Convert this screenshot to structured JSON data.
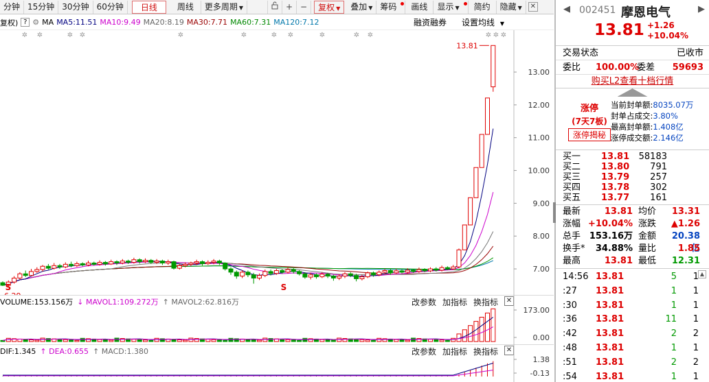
{
  "toolbar": {
    "items": [
      "分钟",
      "15分钟",
      "30分钟",
      "60分钟",
      "日线",
      "周线",
      "更多周期"
    ],
    "active": "日线",
    "fq": "复权",
    "overlay": "叠加",
    "chip": "筹码",
    "draw": "画线",
    "display": "显示",
    "simple": "简约",
    "hide": "隐藏"
  },
  "ma_legend": {
    "prefix": "复权)",
    "ma": "MA",
    "ma5": "MA5:11.51",
    "ma10": "MA10:9.49",
    "ma20": "MA20:8.19",
    "ma30": "MA30:7.71",
    "ma60": "MA60:7.31",
    "ma120": "MA120:7.12",
    "margin": "融资融券",
    "set_ma": "设置均线"
  },
  "colors": {
    "up": "#e00000",
    "down": "#009900",
    "ma5": "#000080",
    "ma10": "#cc00cc",
    "ma20": "#777777",
    "ma30": "#990000",
    "ma60": "#009900",
    "ma120": "#0077aa"
  },
  "chart_data": {
    "type": "candlestick",
    "yticks": [
      "13.00",
      "12.00",
      "11.00",
      "10.00",
      "9.00",
      "8.00",
      "7.00"
    ],
    "ylim": [
      6.5,
      13.9
    ],
    "last_price_label": "13.81",
    "low_label": "6.29",
    "candles": [
      [
        6.58,
        6.5,
        6.62,
        6.48
      ],
      [
        6.5,
        6.6,
        6.65,
        6.45
      ],
      [
        6.6,
        6.72,
        6.78,
        6.55
      ],
      [
        6.72,
        6.85,
        6.9,
        6.68
      ],
      [
        6.85,
        6.8,
        6.95,
        6.75
      ],
      [
        6.8,
        6.92,
        7.0,
        6.78
      ],
      [
        6.92,
        6.98,
        7.05,
        6.88
      ],
      [
        6.98,
        7.08,
        7.12,
        6.92
      ],
      [
        7.08,
        7.02,
        7.15,
        6.98
      ],
      [
        7.02,
        7.1,
        7.18,
        6.98
      ],
      [
        7.1,
        7.06,
        7.15,
        7.0
      ],
      [
        7.06,
        7.14,
        7.2,
        7.02
      ],
      [
        7.14,
        7.1,
        7.22,
        7.05
      ],
      [
        7.1,
        7.16,
        7.22,
        7.06
      ],
      [
        7.16,
        7.12,
        7.2,
        7.08
      ],
      [
        7.12,
        7.18,
        7.25,
        7.08
      ],
      [
        7.18,
        7.14,
        7.22,
        7.1
      ],
      [
        7.14,
        7.2,
        7.26,
        7.1
      ],
      [
        7.2,
        7.15,
        7.24,
        7.1
      ],
      [
        7.15,
        7.22,
        7.28,
        7.12
      ],
      [
        7.22,
        7.18,
        7.26,
        7.12
      ],
      [
        7.18,
        7.24,
        7.3,
        7.14
      ],
      [
        7.24,
        7.2,
        7.28,
        7.15
      ],
      [
        7.2,
        7.28,
        7.34,
        7.16
      ],
      [
        7.28,
        7.22,
        7.32,
        7.16
      ],
      [
        7.22,
        7.26,
        7.32,
        7.18
      ],
      [
        7.26,
        7.2,
        7.3,
        7.15
      ],
      [
        7.2,
        7.24,
        7.3,
        7.15
      ],
      [
        7.24,
        7.18,
        7.28,
        7.12
      ],
      [
        7.18,
        7.22,
        7.28,
        7.12
      ],
      [
        7.22,
        7.02,
        7.25,
        6.98
      ],
      [
        7.02,
        7.1,
        7.15,
        6.98
      ],
      [
        7.1,
        7.14,
        7.2,
        7.05
      ],
      [
        7.14,
        7.18,
        7.22,
        7.08
      ],
      [
        7.18,
        7.22,
        7.28,
        7.12
      ],
      [
        7.22,
        7.16,
        7.26,
        7.1
      ],
      [
        7.16,
        7.2,
        7.26,
        7.12
      ],
      [
        7.2,
        7.24,
        7.3,
        7.14
      ],
      [
        7.24,
        7.18,
        7.28,
        7.12
      ],
      [
        7.18,
        7.0,
        7.2,
        6.95
      ],
      [
        7.0,
        6.9,
        7.05,
        6.82
      ],
      [
        6.9,
        6.78,
        6.95,
        6.7
      ],
      [
        6.78,
        6.9,
        6.96,
        6.72
      ],
      [
        6.9,
        6.82,
        6.95,
        6.75
      ],
      [
        6.82,
        6.72,
        6.88,
        6.55
      ],
      [
        6.72,
        6.8,
        6.86,
        6.66
      ],
      [
        6.8,
        6.92,
        6.98,
        6.75
      ],
      [
        6.92,
        6.86,
        6.98,
        6.8
      ],
      [
        6.86,
        6.95,
        7.0,
        6.82
      ],
      [
        6.95,
        6.9,
        7.0,
        6.85
      ],
      [
        6.9,
        6.98,
        7.04,
        6.86
      ],
      [
        6.98,
        6.92,
        7.02,
        6.86
      ],
      [
        6.92,
        6.85,
        6.96,
        6.8
      ],
      [
        6.85,
        6.75,
        6.9,
        6.7
      ],
      [
        6.75,
        6.82,
        6.88,
        6.68
      ],
      [
        6.82,
        6.76,
        6.86,
        6.7
      ],
      [
        6.76,
        6.84,
        6.9,
        6.72
      ],
      [
        6.84,
        6.78,
        6.88,
        6.72
      ],
      [
        6.78,
        6.72,
        6.82,
        6.64
      ],
      [
        6.72,
        6.78,
        6.84,
        6.66
      ],
      [
        6.78,
        6.85,
        6.9,
        6.72
      ],
      [
        6.85,
        6.8,
        6.9,
        6.75
      ],
      [
        6.8,
        6.7,
        6.85,
        6.62
      ],
      [
        6.7,
        6.76,
        6.82,
        6.65
      ],
      [
        6.76,
        6.88,
        6.92,
        6.72
      ],
      [
        6.88,
        6.82,
        6.92,
        6.76
      ],
      [
        6.82,
        6.9,
        6.95,
        6.78
      ],
      [
        6.9,
        6.95,
        7.0,
        6.85
      ],
      [
        6.95,
        6.88,
        7.0,
        6.82
      ],
      [
        6.88,
        6.94,
        7.0,
        6.84
      ],
      [
        6.94,
        6.9,
        6.98,
        6.86
      ],
      [
        6.9,
        6.96,
        7.02,
        6.86
      ],
      [
        6.96,
        6.92,
        7.0,
        6.88
      ],
      [
        6.92,
        6.98,
        7.04,
        6.88
      ],
      [
        6.98,
        6.94,
        7.02,
        6.9
      ],
      [
        6.94,
        7.0,
        7.05,
        6.9
      ],
      [
        7.0,
        6.96,
        7.05,
        6.92
      ],
      [
        6.96,
        7.04,
        7.1,
        6.92
      ],
      [
        7.04,
        7.0,
        7.08,
        6.96
      ],
      [
        7.0,
        7.06,
        7.12,
        6.98
      ],
      [
        7.06,
        7.58,
        7.62,
        7.02
      ],
      [
        7.58,
        8.34,
        8.34,
        7.58
      ],
      [
        8.34,
        9.17,
        9.17,
        9.1
      ],
      [
        9.17,
        10.09,
        10.09,
        10.09
      ],
      [
        10.09,
        11.1,
        11.1,
        10.2
      ],
      [
        11.1,
        12.21,
        12.21,
        11.3
      ],
      [
        12.55,
        13.81,
        13.81,
        12.4
      ]
    ],
    "vol_ticks": [
      "173.00",
      "0.00"
    ],
    "macd_ticks": [
      "1.38",
      "-0.13"
    ]
  },
  "vol_panel": {
    "vol": "VOLUME:153.156万",
    "mavol1": "MAVOL1:109.272万",
    "mavol2": "MAVOL2:62.816万",
    "tools": [
      "改参数",
      "加指标",
      "换指标"
    ]
  },
  "macd_panel": {
    "dif": "DIF:1.345",
    "dea": "DEA:0.655",
    "macd": "MACD:1.380",
    "tools": [
      "改参数",
      "加指标",
      "换指标"
    ]
  },
  "quote": {
    "code": "002451",
    "name": "摩恩电气",
    "price": "13.81",
    "change": "+1.26",
    "change_pct": "+10.04%",
    "state_label": "交易状态",
    "state_value": "已收市",
    "wb_label": "委比",
    "wb_value": "100.00%",
    "wc_label": "委差",
    "wc_value": "59693",
    "l2_link": "购买L2查看十档行情"
  },
  "limit_up": {
    "title": "涨停",
    "streak": "(7天7板)",
    "reveal": "涨停揭秘",
    "rows": [
      {
        "k": "当前封单额:",
        "v": "8035.07万"
      },
      {
        "k": "封单占成交:",
        "v": "3.80%"
      },
      {
        "k": "最高封单额:",
        "v": "1.408亿"
      },
      {
        "k": "涨停成交额:",
        "v": "2.146亿"
      }
    ]
  },
  "book": [
    {
      "l": "买一",
      "p": "13.81",
      "q": "58183"
    },
    {
      "l": "买二",
      "p": "13.80",
      "q": "791"
    },
    {
      "l": "买三",
      "p": "13.79",
      "q": "257"
    },
    {
      "l": "买四",
      "p": "13.78",
      "q": "302"
    },
    {
      "l": "买五",
      "p": "13.77",
      "q": "161"
    }
  ],
  "stats": [
    {
      "k1": "最新",
      "v1": "13.81",
      "c1": "red",
      "k2": "均价",
      "v2": "13.31",
      "c2": "red"
    },
    {
      "k1": "涨幅",
      "v1": "+10.04%",
      "c1": "red",
      "k2": "涨跌",
      "v2": "▲1.26",
      "c2": "red"
    },
    {
      "k1": "总手",
      "v1": "153.16万",
      "c1": "",
      "k2": "金额",
      "v2": "20.38亿",
      "c2": "blue"
    },
    {
      "k1": "换手*",
      "v1": "34.88%",
      "c1": "",
      "k2": "量比",
      "v2": "1.85",
      "c2": "red"
    },
    {
      "k1": "最高",
      "v1": "13.81",
      "c1": "red",
      "k2": "最低",
      "v2": "12.31",
      "c2": "green"
    }
  ],
  "ticks": [
    {
      "t": "14:56",
      "p": "13.81",
      "v": "5",
      "n": "1"
    },
    {
      "t": ":27",
      "p": "13.81",
      "v": "1",
      "n": "1"
    },
    {
      "t": ":30",
      "p": "13.81",
      "v": "1",
      "n": "1"
    },
    {
      "t": ":36",
      "p": "13.81",
      "v": "11",
      "n": "1"
    },
    {
      "t": ":42",
      "p": "13.81",
      "v": "2",
      "n": "2"
    },
    {
      "t": ":48",
      "p": "13.81",
      "v": "1",
      "n": "1"
    },
    {
      "t": ":51",
      "p": "13.81",
      "v": "2",
      "n": "2"
    },
    {
      "t": ":54",
      "p": "13.81",
      "v": "1",
      "n": "1"
    }
  ]
}
